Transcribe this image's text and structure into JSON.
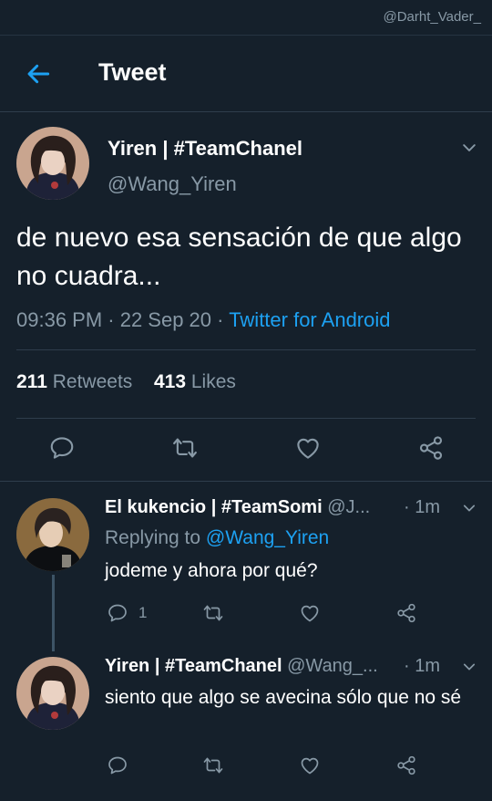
{
  "watermark": "@Darht_Vader_",
  "header": {
    "title": "Tweet"
  },
  "tweet": {
    "name": "Yiren | #TeamChanel",
    "handle": "@Wang_Yiren",
    "text": "de nuevo esa sensación de que algo no cuadra...",
    "time": "09:36 PM · 22 Sep 20 · ",
    "source": "Twitter for Android",
    "retweets_count": "211",
    "retweets_label": "Retweets",
    "likes_count": "413",
    "likes_label": "Likes"
  },
  "replies": [
    {
      "name": "El kukencio | #TeamSomi",
      "handle": "@J...",
      "time": "· 1m",
      "replying_prefix": "Replying to ",
      "replying_to": "@Wang_Yiren",
      "text": "jodeme y ahora por qué?",
      "reply_count": "1"
    },
    {
      "name": "Yiren | #TeamChanel",
      "handle": "@Wang_...",
      "time": "· 1m",
      "text": "siento que algo se avecina sólo que no sé"
    }
  ],
  "icons": {
    "back": "arrow-left-icon",
    "chevron": "chevron-down-icon",
    "reply": "speech-bubble-icon",
    "retweet": "retweet-icon",
    "like": "heart-icon",
    "share": "share-icon"
  },
  "colors": {
    "background": "#15202b",
    "accent": "#1da1f2",
    "secondary_text": "#8899a6",
    "separator": "#2f3d4c"
  }
}
